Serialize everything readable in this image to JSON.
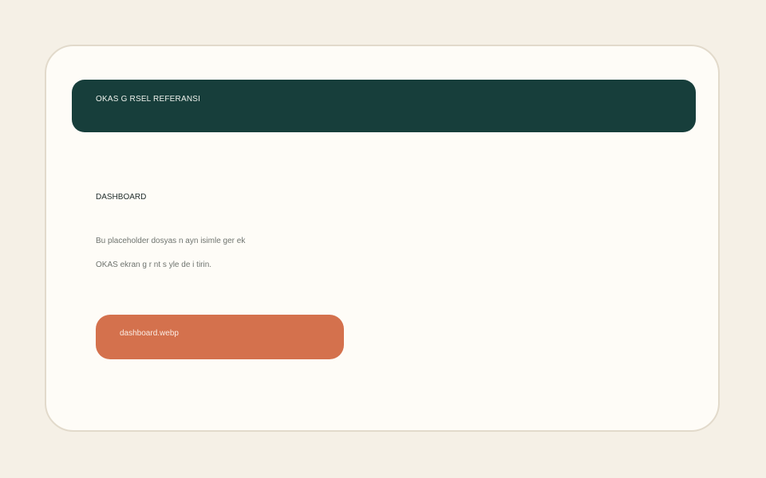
{
  "banner": {
    "title": "OKAS  G  RSEL REFERANSI"
  },
  "content": {
    "heading": "DASHBOARD",
    "description_lines": [
      "Bu placeholder dosyas  n  ayn  isimle ger  ek",
      "OKAS ekran g  r  nt  s  yle de  i  tirin."
    ],
    "file_name": "dashboard.webp"
  },
  "colors": {
    "page_background": "#f5f0e6",
    "card_background": "#fefcf7",
    "card_border": "#e2dacb",
    "banner_background": "#173e3b",
    "accent": "#d4714d"
  }
}
